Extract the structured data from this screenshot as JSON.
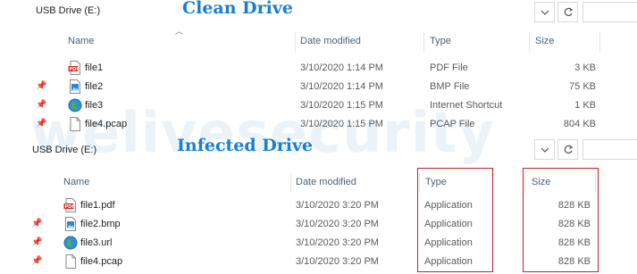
{
  "watermark": "welivesecurity",
  "panels": {
    "clean": {
      "address": "USB Drive (E:)",
      "title": "Clean Drive",
      "columns": {
        "name": "Name",
        "date": "Date modified",
        "type": "Type",
        "size": "Size"
      },
      "files": [
        {
          "name": "file1",
          "date": "3/10/2020 1:14 PM",
          "type": "PDF File",
          "size": "3 KB",
          "icon": "pdf-file-icon"
        },
        {
          "name": "file2",
          "date": "3/10/2020 1:14 PM",
          "type": "BMP File",
          "size": "75 KB",
          "icon": "image-file-icon"
        },
        {
          "name": "file3",
          "date": "3/10/2020 1:15 PM",
          "type": "Internet Shortcut",
          "size": "1 KB",
          "icon": "internet-shortcut-icon"
        },
        {
          "name": "file4.pcap",
          "date": "3/10/2020 1:15 PM",
          "type": "PCAP File",
          "size": "804 KB",
          "icon": "generic-file-icon"
        }
      ]
    },
    "infected": {
      "address": "USB Drive (E:)",
      "title": "Infected Drive",
      "columns": {
        "name": "Name",
        "date": "Date modified",
        "type": "Type",
        "size": "Size"
      },
      "files": [
        {
          "name": "file1.pdf",
          "date": "3/10/2020 3:20 PM",
          "type": "Application",
          "size": "828 KB",
          "icon": "pdf-file-icon"
        },
        {
          "name": "file2.bmp",
          "date": "3/10/2020 3:20 PM",
          "type": "Application",
          "size": "828 KB",
          "icon": "image-file-icon"
        },
        {
          "name": "file3.url",
          "date": "3/10/2020 3:20 PM",
          "type": "Application",
          "size": "828 KB",
          "icon": "internet-shortcut-icon"
        },
        {
          "name": "file4.pcap",
          "date": "3/10/2020 3:20 PM",
          "type": "Application",
          "size": "828 KB",
          "icon": "generic-file-icon"
        }
      ]
    }
  },
  "colors": {
    "title": "#1a7fcc",
    "highlight": "#c8202a",
    "header_text": "#4c607a"
  }
}
